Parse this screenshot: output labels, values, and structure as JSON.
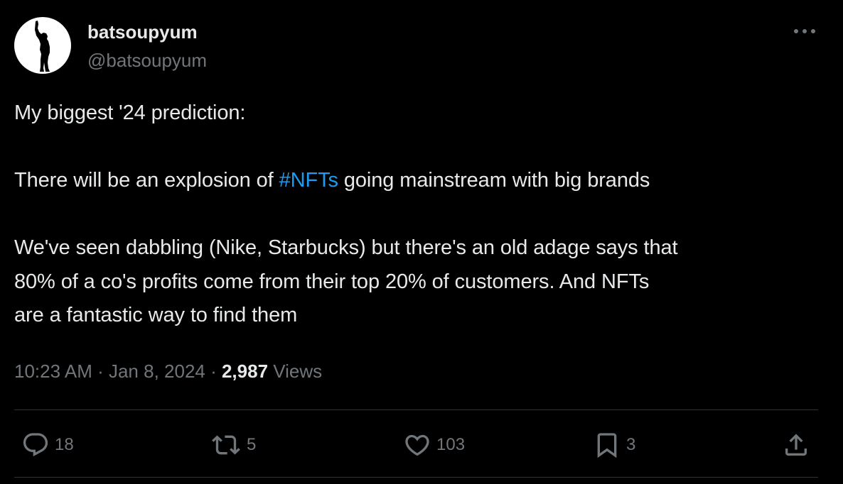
{
  "author": {
    "display_name": "batsoupyum",
    "handle": "@batsoupyum"
  },
  "tweet": {
    "line1": "My biggest '24 prediction:",
    "line2_before": "There will be an explosion of ",
    "hashtag": "#NFTs",
    "line2_after": " going mainstream with big brands",
    "line3": "We've seen dabbling (Nike, Starbucks) but there's an old adage says that",
    "line4": "80% of a co's profits come from their top 20% of customers. And NFTs",
    "line5": "are a fantastic way to find them"
  },
  "meta": {
    "time": "10:23 AM",
    "separator1": " · ",
    "date": "Jan 8, 2024",
    "separator2": " · ",
    "views_count": "2,987",
    "views_label": " Views"
  },
  "actions": {
    "replies": "18",
    "retweets": "5",
    "likes": "103",
    "bookmarks": "3"
  },
  "icons": {
    "more": "more-horizontal-icon",
    "reply": "reply-bubble-icon",
    "retweet": "retweet-arrows-icon",
    "like": "heart-icon",
    "bookmark": "bookmark-icon",
    "share": "share-upload-icon"
  },
  "colors": {
    "background": "#000000",
    "text": "#e7e9ea",
    "muted": "#71767b",
    "link": "#1d9bf0",
    "divider": "#2f3336"
  }
}
